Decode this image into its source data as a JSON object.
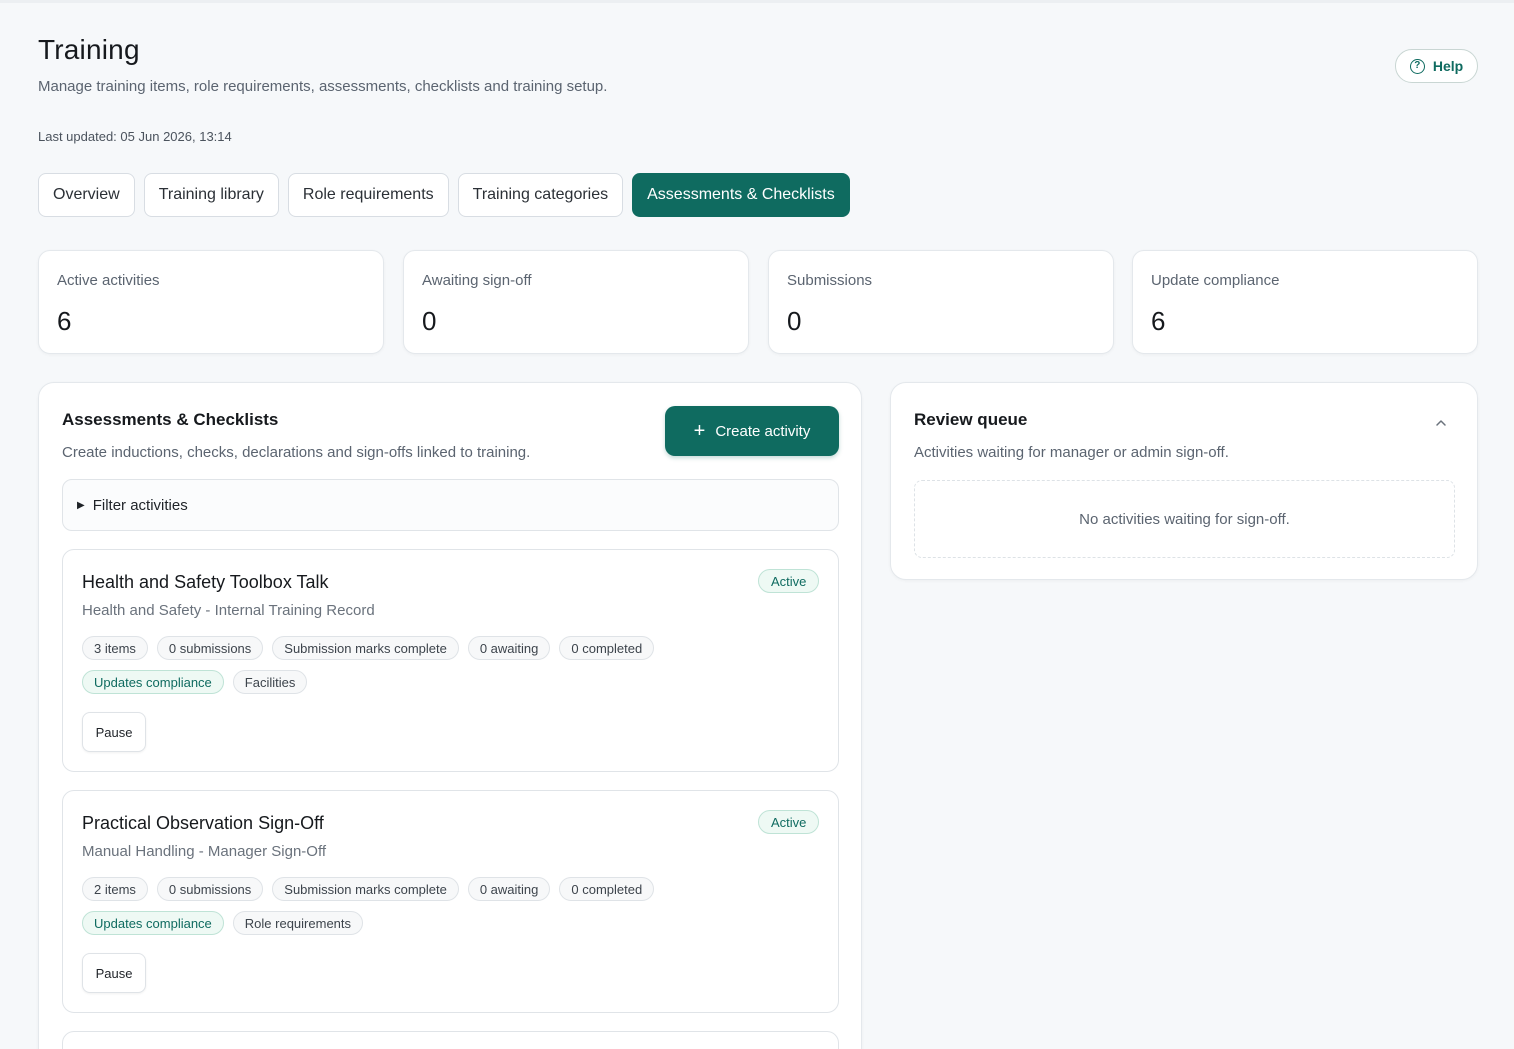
{
  "header": {
    "title": "Training",
    "subtitle": "Manage training items, role requirements, assessments, checklists and training setup.",
    "last_updated_label": "Last updated:",
    "last_updated_value": "05 Jun 2026, 13:14",
    "help_label": "Help",
    "help_icon": "question-circle-icon"
  },
  "tabs": [
    {
      "label": "Overview",
      "active": false
    },
    {
      "label": "Training library",
      "active": false
    },
    {
      "label": "Role requirements",
      "active": false
    },
    {
      "label": "Training categories",
      "active": false
    },
    {
      "label": "Assessments & Checklists",
      "active": true
    }
  ],
  "stats": [
    {
      "label": "Active activities",
      "value": "6"
    },
    {
      "label": "Awaiting sign-off",
      "value": "0"
    },
    {
      "label": "Submissions",
      "value": "0"
    },
    {
      "label": "Update compliance",
      "value": "6"
    }
  ],
  "main_panel": {
    "title": "Assessments & Checklists",
    "description": "Create inductions, checks, declarations and sign-offs linked to training.",
    "create_label": "Create activity",
    "create_icon": "plus-icon",
    "filter_label": "Filter activities",
    "filter_icon": "triangle-right-icon"
  },
  "activities": [
    {
      "title": "Health and Safety Toolbox Talk",
      "subtitle": "Health and Safety - Internal Training Record",
      "status": "Active",
      "chips_row1": [
        "3 items",
        "0 submissions",
        "Submission marks complete",
        "0 awaiting",
        "0 completed"
      ],
      "chips_row2": [
        "Updates compliance",
        "Facilities"
      ],
      "pause_label": "Pause"
    },
    {
      "title": "Practical Observation Sign-Off",
      "subtitle": "Manual Handling - Manager Sign-Off",
      "status": "Active",
      "chips_row1": [
        "2 items",
        "0 submissions",
        "Submission marks complete",
        "0 awaiting",
        "0 completed"
      ],
      "chips_row2": [
        "Updates compliance",
        "Role requirements"
      ],
      "pause_label": "Pause"
    }
  ],
  "review_panel": {
    "title": "Review queue",
    "description": "Activities waiting for manager or admin sign-off.",
    "empty_text": "No activities waiting for sign-off.",
    "collapse_icon": "chevron-up-icon"
  },
  "colors": {
    "accent": "#0f6b60",
    "background": "#f6f8fa",
    "status_bg": "#eef9f4"
  }
}
